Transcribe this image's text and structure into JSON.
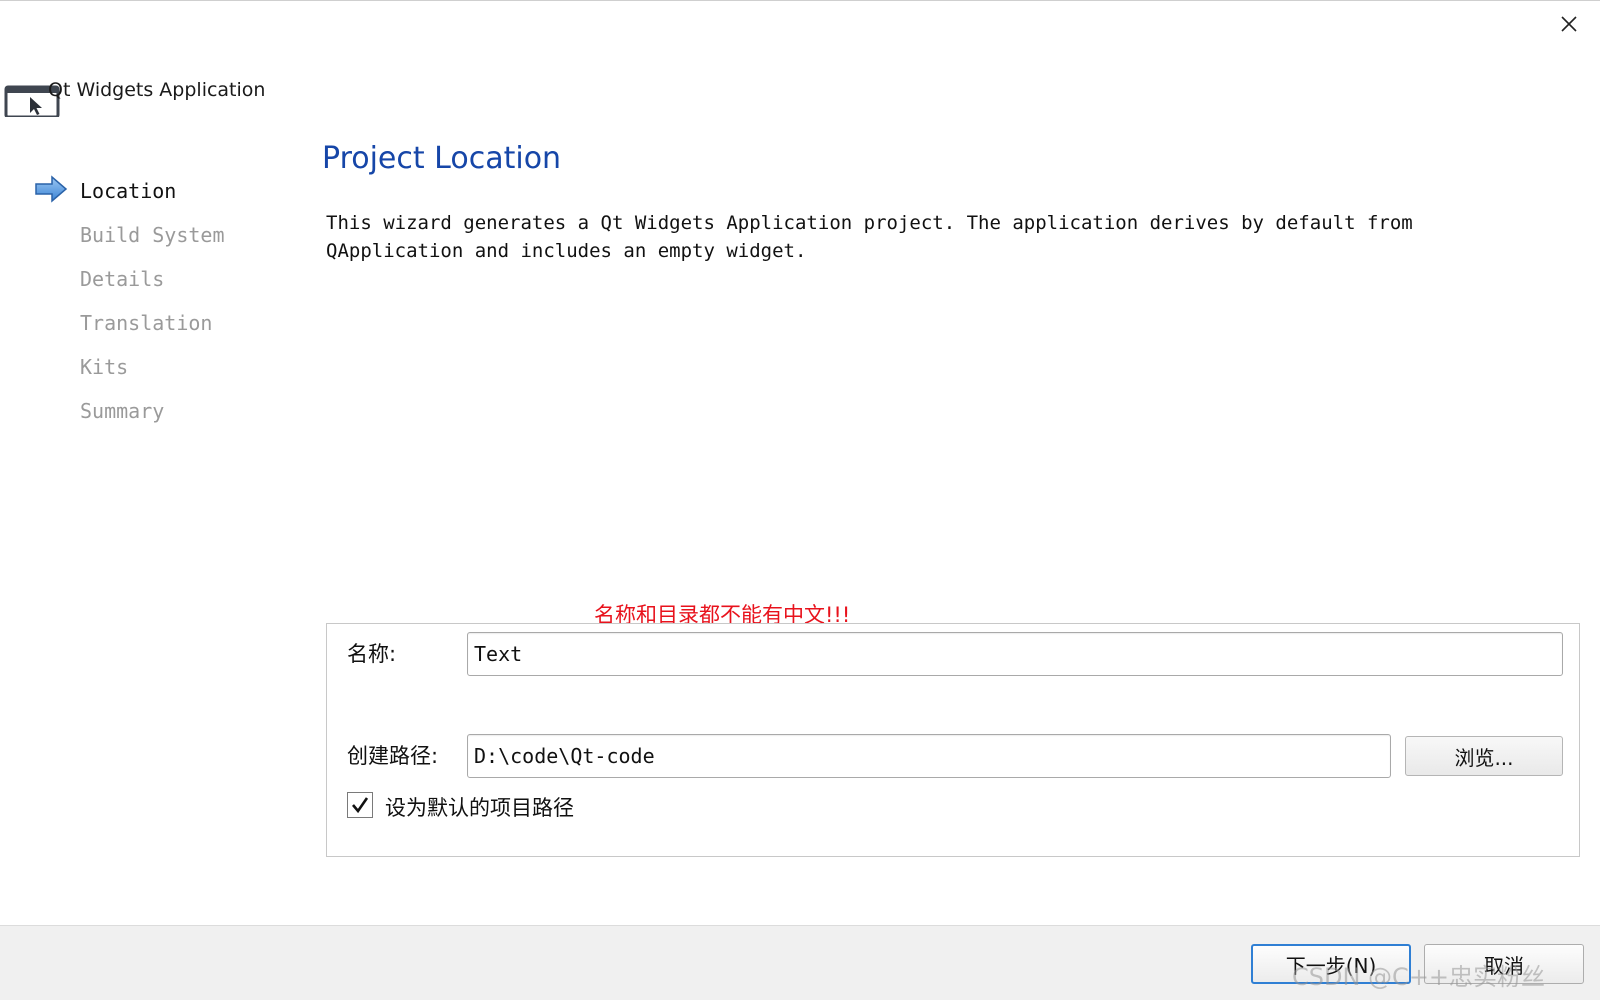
{
  "window": {
    "app_title": "Qt Widgets Application"
  },
  "wizard_steps": [
    {
      "label": "Location",
      "current": true
    },
    {
      "label": "Build System",
      "current": false
    },
    {
      "label": "Details",
      "current": false
    },
    {
      "label": "Translation",
      "current": false
    },
    {
      "label": "Kits",
      "current": false
    },
    {
      "label": "Summary",
      "current": false
    }
  ],
  "page": {
    "title": "Project Location",
    "description": "This wizard generates a Qt Widgets Application project. The application derives by default from QApplication and includes an empty widget."
  },
  "annotation": {
    "warning": "名称和目录都不能有中文!!!",
    "warning_color": "#e8121c"
  },
  "form": {
    "name_label": "名称:",
    "name_value": "Text",
    "path_label": "创建路径:",
    "path_value": "D:\\code\\Qt-code",
    "browse_label": "浏览...",
    "default_path_label": "设为默认的项目路径",
    "default_path_checked": true
  },
  "footer": {
    "next_label": "下一步(N)",
    "cancel_label": "取消"
  },
  "watermark": "CSDN @C++忠实粉丝",
  "colors": {
    "title_blue": "#1646a8",
    "primary_border": "#2f7fd4",
    "inactive_step": "#9a9a9a"
  }
}
